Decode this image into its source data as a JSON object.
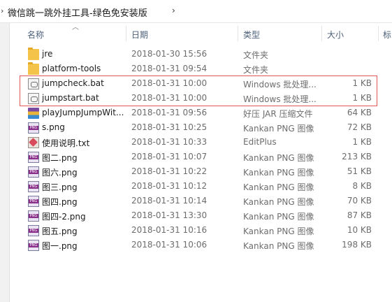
{
  "breadcrumb": {
    "text": "微信跳一跳外挂工具-绿色免安装版",
    "separator": "›",
    "dropdown": "›"
  },
  "columns": {
    "name": "名称",
    "date": "日期",
    "type": "类型",
    "size": "大小",
    "tags": "标"
  },
  "files": [
    {
      "name": "jre",
      "date": "2018-01-30 15:56",
      "type": "文件夹",
      "size": "",
      "icon": "folder-icon"
    },
    {
      "name": "platform-tools",
      "date": "2018-01-31 09:54",
      "type": "文件夹",
      "size": "",
      "icon": "folder-icon"
    },
    {
      "name": "jumpcheck.bat",
      "date": "2018-01-31 10:00",
      "type": "Windows 批处理...",
      "size": "1 KB",
      "icon": "batch-file-icon"
    },
    {
      "name": "jumpstart.bat",
      "date": "2018-01-31 10:00",
      "type": "Windows 批处理...",
      "size": "1 KB",
      "icon": "batch-file-icon"
    },
    {
      "name": "playJumpJumpWit...",
      "date": "2018-01-31 09:56",
      "type": "好压 JAR 压缩文件",
      "size": "64 KB",
      "icon": "jar-archive-icon"
    },
    {
      "name": "s.png",
      "date": "2018-01-31 10:25",
      "type": "Kankan PNG 图像",
      "size": "72 KB",
      "icon": "png-image-icon"
    },
    {
      "name": "使用说明.txt",
      "date": "2018-01-31 10:33",
      "type": "EditPlus",
      "size": "1 KB",
      "icon": "text-file-icon"
    },
    {
      "name": "图二.png",
      "date": "2018-01-31 10:07",
      "type": "Kankan PNG 图像",
      "size": "213 KB",
      "icon": "png-image-icon"
    },
    {
      "name": "图六.png",
      "date": "2018-01-31 10:22",
      "type": "Kankan PNG 图像",
      "size": "51 KB",
      "icon": "png-image-icon"
    },
    {
      "name": "图三.png",
      "date": "2018-01-31 10:12",
      "type": "Kankan PNG 图像",
      "size": "8 KB",
      "icon": "png-image-icon"
    },
    {
      "name": "图四.png",
      "date": "2018-01-31 10:14",
      "type": "Kankan PNG 图像",
      "size": "70 KB",
      "icon": "png-image-icon"
    },
    {
      "name": "图四-2.png",
      "date": "2018-01-31 13:30",
      "type": "Kankan PNG 图像",
      "size": "87 KB",
      "icon": "png-image-icon"
    },
    {
      "name": "图五.png",
      "date": "2018-01-31 10:16",
      "type": "Kankan PNG 图像",
      "size": "10 KB",
      "icon": "png-image-icon"
    },
    {
      "name": "图一.png",
      "date": "2018-01-31 10:06",
      "type": "Kankan PNG 图像",
      "size": "198 KB",
      "icon": "png-image-icon"
    }
  ]
}
